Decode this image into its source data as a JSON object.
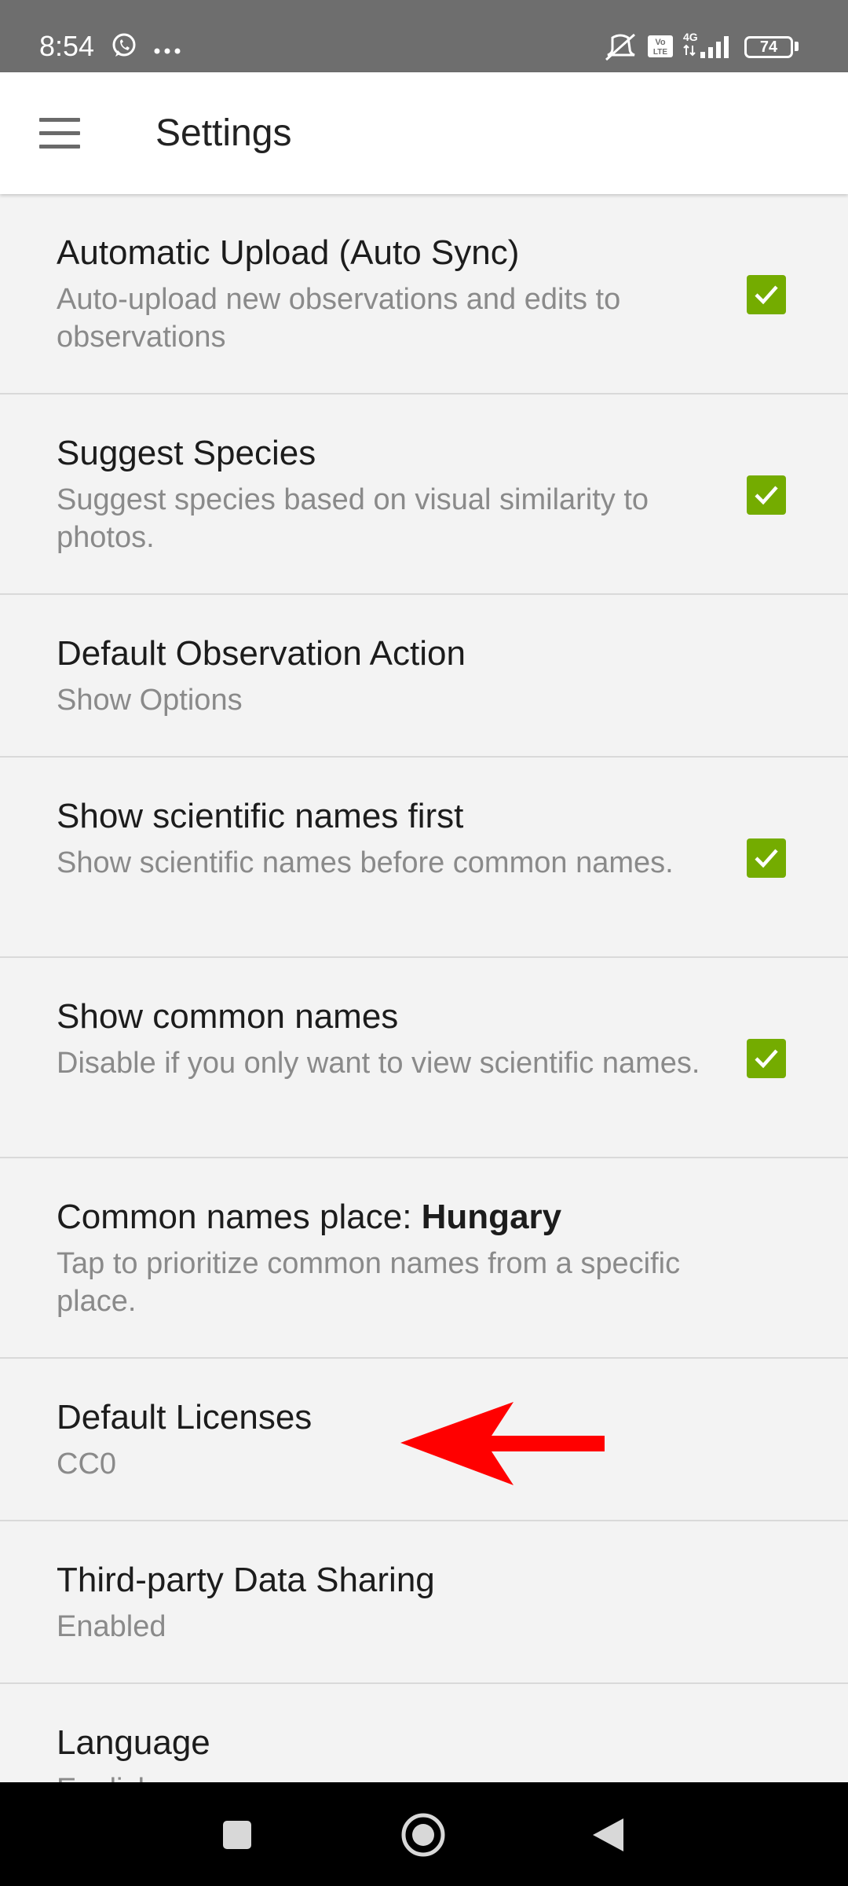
{
  "status_bar": {
    "time": "8:54",
    "icons": [
      "whatsapp-icon",
      "more-notifications-icon",
      "vibrate-off-icon",
      "volte-icon",
      "4g-signal-icon"
    ],
    "battery": "74"
  },
  "app_bar": {
    "title": "Settings",
    "menu_icon": "hamburger-menu-icon"
  },
  "settings": [
    {
      "title": "Automatic Upload (Auto Sync)",
      "subtitle": "Auto-upload new observations and edits to observations",
      "checked": true
    },
    {
      "title": "Suggest Species",
      "subtitle": "Suggest species based on visual similarity to photos.",
      "checked": true
    },
    {
      "title": "Default Observation Action",
      "subtitle": "Show Options"
    },
    {
      "title": "Show scientific names first",
      "subtitle": "Show scientific names before common names.",
      "checked": true
    },
    {
      "title": "Show common names",
      "subtitle": "Disable if you only want to view scientific names.",
      "checked": true
    },
    {
      "title_prefix": "Common names place: ",
      "title_bold": "Hungary",
      "subtitle": "Tap to prioritize common names from a specific place."
    },
    {
      "title": "Default Licenses",
      "subtitle": "CC0"
    },
    {
      "title": "Third-party Data Sharing",
      "subtitle": "Enabled"
    },
    {
      "title": "Language",
      "subtitle": "English"
    }
  ],
  "colors": {
    "checkbox": "#74ac00",
    "annotation_arrow": "#ff0000",
    "status_bar": "#6e6e6e"
  },
  "nav_bar": {
    "icons": [
      "recents-square-icon",
      "home-circle-icon",
      "back-triangle-icon"
    ]
  }
}
